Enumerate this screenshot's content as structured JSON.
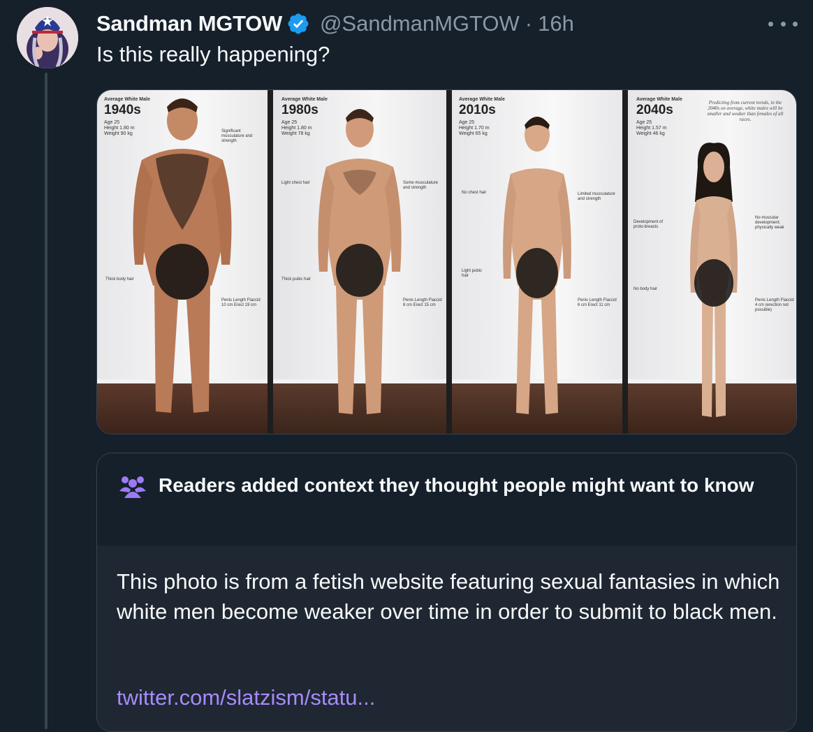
{
  "tweet": {
    "display_name": "Sandman MGTOW",
    "handle": "@SandmanMGTOW",
    "separator": "·",
    "time": "16h",
    "text": "Is this really happening?",
    "icons": {
      "verified": "verified-badge-icon",
      "more": "more-options-icon",
      "avatar": "avatar"
    },
    "colors": {
      "background": "#15202b",
      "secondary_text": "#8b98a5",
      "verified": "#1d9bf0",
      "link": "#a78bfa"
    }
  },
  "media": {
    "panels": [
      {
        "header": "Average White Male",
        "era": "1940s",
        "stats": [
          "Age 25",
          "Height 1.80 m",
          "Weight 90 kg"
        ],
        "notes": [
          "Significant musculature and strength",
          "Thick body hair",
          "Penis Length Flaccid 10 cm Erect 19 cm"
        ]
      },
      {
        "header": "Average White Male",
        "era": "1980s",
        "stats": [
          "Age 25",
          "Height 1.80 m",
          "Weight 78 kg"
        ],
        "notes": [
          "Light chest hair",
          "Some musculature and strength",
          "Thick pubic hair",
          "Penis Length Flaccid 8 cm Erect 15 cm"
        ]
      },
      {
        "header": "Average White Male",
        "era": "2010s",
        "stats": [
          "Age 25",
          "Height 1.70 m",
          "Weight 65 kg"
        ],
        "notes": [
          "No chest hair",
          "Limited musculature and strength",
          "Light pubic hair",
          "Penis Length Flaccid 6 cm Erect 11 cm"
        ]
      },
      {
        "header": "Average White Male",
        "era": "2040s",
        "stats": [
          "Age 25",
          "Height 1.57 m",
          "Weight 46 kg"
        ],
        "prediction": "Predicting from current trends, in the 2040s on average, white males will be smaller and weaker than females of all races.",
        "notes": [
          "Development of proto-breasts",
          "No muscular development; physically weak",
          "No body hair",
          "Penis Length Flaccid 4 cm (erection not possible)"
        ]
      }
    ]
  },
  "context": {
    "icon": "readers-people-icon",
    "title": "Readers added context they thought people might want to know",
    "body": "This photo is from a fetish website featuring sexual fantasies in which white men become weaker over time in order to submit to black men.",
    "link": "twitter.com/slatzism/statu..."
  }
}
